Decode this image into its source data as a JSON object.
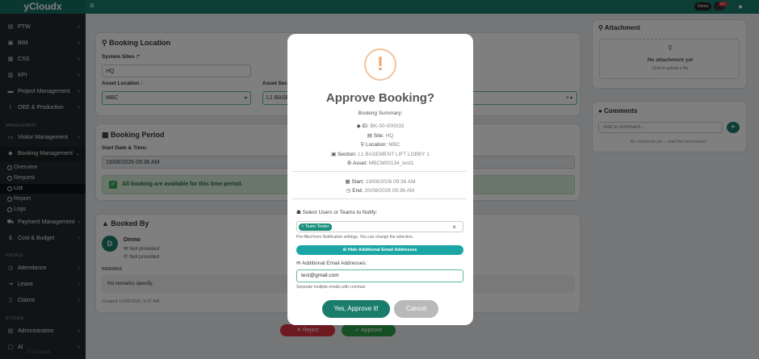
{
  "app": {
    "brand": "yCloudx",
    "user_badge": "Demo",
    "notif_count": "99+"
  },
  "sidebar": {
    "items": [
      {
        "label": "PTW",
        "icon": "file-icon"
      },
      {
        "label": "BIM",
        "icon": "cube-icon"
      },
      {
        "label": "CSS",
        "icon": "table-icon"
      },
      {
        "label": "KPI",
        "icon": "chart-icon"
      },
      {
        "label": "Project Management",
        "icon": "briefcase-icon"
      },
      {
        "label": "OEE & Production",
        "icon": "line-chart-icon"
      }
    ],
    "section_management": "MANAGEMENT",
    "visitor": "Visitor Management",
    "booking": "Booking Management",
    "sub": [
      "Overview",
      "Request",
      "List",
      "Report",
      "Logs"
    ],
    "payment": "Payment Management",
    "cost": "Cost & Budget",
    "section_people": "PEOPLE",
    "attendance": "Attendance",
    "leave": "Leave",
    "claims": "Claims",
    "section_system": "SYSTEM",
    "administration": "Administration",
    "al": "Al",
    "footer": "© yCloudx"
  },
  "location": {
    "title": "Booking Location",
    "system_sites_label": "System Sites :*",
    "system_sites_value": "HQ",
    "asset_location_label": "Asset Location :",
    "asset_location_value": "MBC",
    "asset_section_label": "Asset Sect",
    "asset_section_value": "L1 BASE"
  },
  "period": {
    "title": "Booking Period",
    "start_label": "Start Date & Time:",
    "start_value": "19/08/2026 09:36 AM",
    "available": "All booking are available for this time period."
  },
  "booked_by": {
    "title": "Booked By",
    "initial": "D",
    "name": "Demo",
    "email": "Not provided",
    "phone": "Not provided",
    "remarks_label": "REMARKS",
    "remarks_value": "No remarks specify.",
    "created": "Created 11/08/2026, 9:37 AM"
  },
  "actions": {
    "reject": "Reject",
    "approve": "Approve"
  },
  "attachment": {
    "title": "Attachment",
    "empty": "No attachment yet",
    "hint": "Click to upload a file"
  },
  "comments": {
    "title": "Comments",
    "placeholder": "Add a comment...",
    "empty": "No comments yet — start the conversation"
  },
  "modal": {
    "icon": "!",
    "title": "Approve Booking?",
    "summary_label": "Booking Summary:",
    "id_key": "ID:",
    "id_val": "BK-00-000033",
    "site_key": "Site:",
    "site_val": "HQ",
    "location_key": "Location:",
    "location_val": "MBC",
    "section_key": "Section:",
    "section_val": "L1 BASEMENT LIFT LOBBY 1",
    "asset_key": "Asset:",
    "asset_val": "MBCM00134_test1",
    "start_key": "Start:",
    "start_val": "19/08/2026 09:36 AM",
    "end_key": "End:",
    "end_val": "20/08/2026 09:36 AM",
    "notify_label": "Select Users or Teams to Notify:",
    "team_tag": "Team Tester",
    "prefilled_hint": "Pre-filled from Notification settings. You can change the selection.",
    "hide_btn": "Hide Additional Email Addresses",
    "email_label": "Additional Email Addresses:",
    "email_value": "test@gmail.com",
    "email_hint": "Separate multiple emails with commas",
    "confirm": "Yes, Approve it!",
    "cancel": "Cancel"
  }
}
